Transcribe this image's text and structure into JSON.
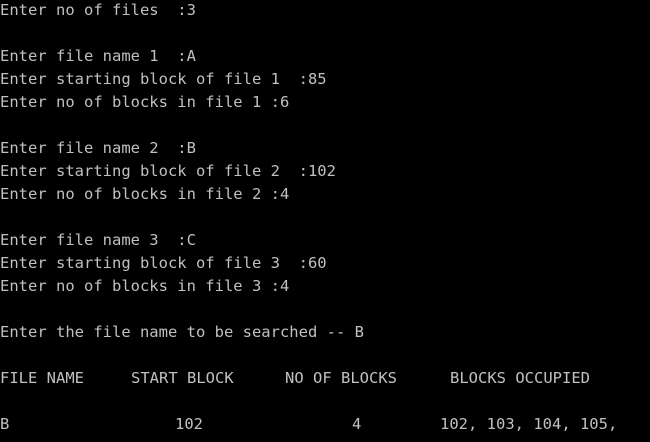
{
  "colors": {
    "background": "#000000",
    "text": "#c0c0c0"
  },
  "terminal": {
    "lines": {
      "num_files": "Enter no of files  :3",
      "file1_name": "Enter file name 1  :A",
      "file1_start": "Enter starting block of file 1  :85",
      "file1_count": "Enter no of blocks in file 1 :6",
      "file2_name": "Enter file name 2  :B",
      "file2_start": "Enter starting block of file 2  :102",
      "file2_count": "Enter no of blocks in file 2 :4",
      "file3_name": "Enter file name 3  :C",
      "file3_start": "Enter starting block of file 3  :60",
      "file3_count": "Enter no of blocks in file 3 :4",
      "search_prompt": "Enter the file name to be searched -- B"
    },
    "result_table": {
      "headers": [
        "FILE NAME",
        "START BLOCK",
        "NO OF BLOCKS",
        "BLOCKS OCCUPIED"
      ],
      "rows": [
        [
          "B",
          "102",
          "4",
          "102, 103, 104, 105,"
        ]
      ]
    }
  }
}
